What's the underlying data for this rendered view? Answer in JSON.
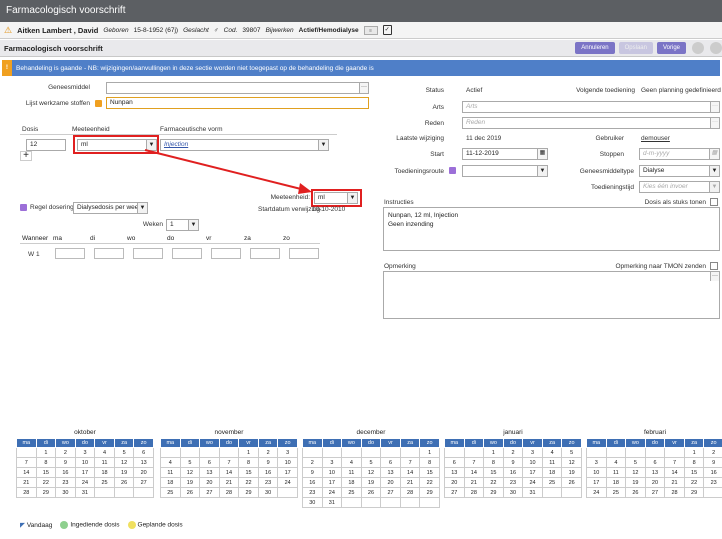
{
  "window": {
    "title": "Farmacologisch voorschrift"
  },
  "patient": {
    "name": "Aitken Lambert , David",
    "born_label": "Geboren",
    "born": "15-8-1952 (67j)",
    "sex_label": "Geslacht",
    "code_label": "Cod.",
    "code": "39807",
    "extra_label": "Bijwerken",
    "extra": "Actief/Hemodialyse"
  },
  "section": {
    "title": "Farmacologisch voorschrift",
    "buttons": {
      "cancel": "Annuleren",
      "confirm": "Opslaan",
      "prev": "Vorige"
    }
  },
  "notice": {
    "icon": "!",
    "text": "Behandeling is gaande - NB: wijzigingen/aanvullingen in deze sectie worden niet toegepast op de behandeling die gaande is"
  },
  "left": {
    "drug_label": "Geneesmiddel",
    "drug_value": "",
    "active_label": "Lijst werkzame stoffen",
    "active_value": "Nunpan",
    "dose_label": "Dosis",
    "dose_value": "12",
    "unit_label": "Meeteenheid",
    "unit_value": "ml",
    "form_label": "Farmaceutische vorm",
    "form_value": "Injection",
    "add": "+",
    "rule_label": "Regel dosering",
    "rule_value": "Dialysedosis per week",
    "unit2_label": "Meeteenheid:",
    "unit2_value": "ml",
    "start_label": "Startdatum verwijzing:",
    "start_value": "10-10-2010",
    "weeks_label": "Weken",
    "weeks_value": "1",
    "week_header": [
      "Wanneer",
      "ma",
      "di",
      "wo",
      "do",
      "vr",
      "za",
      "zo"
    ],
    "week_row": "W 1"
  },
  "right": {
    "status_label": "Status",
    "status_value": "Actief",
    "next_label": "Volgende toediening",
    "next_value": "Geen planning gedefinieerd",
    "doctor_label": "Arts",
    "doctor_ph": "Arts",
    "reason_label": "Reden",
    "reason_ph": "Reden",
    "lastmod_label": "Laatste wijziging",
    "lastmod_value": "11 dec 2019",
    "user_label": "Gebruiker",
    "user_value": "demouser",
    "start_label": "Start",
    "start_value": "11-12-2019",
    "stop_label": "Stoppen",
    "stop_ph": "d-m-yyyy",
    "route_label": "Toedieningsroute",
    "route_value": "",
    "type_label": "Geneesmiddeltype",
    "type_value": "Dialyse",
    "time_label": "Toedieningstijd",
    "time_ph": "Kies één invoer",
    "instr_label": "Instructies",
    "pieces_label": "Dosis als stuks tonen",
    "instr_line1": "Nunpan, 12 ml, Injection",
    "instr_line2": "Geen inzending",
    "remark_label": "Opmerking",
    "tmon_label": "Opmerking naar TMON zenden"
  },
  "calendar": {
    "days": [
      "ma",
      "di",
      "wo",
      "do",
      "vr",
      "za",
      "zo"
    ],
    "months": [
      {
        "name": "oktober",
        "rows": [
          [
            "",
            "1",
            "2",
            "3",
            "4",
            "5",
            "6"
          ],
          [
            "7",
            "8",
            "9",
            "10",
            "11",
            "12",
            "13"
          ],
          [
            "14",
            "15",
            "16",
            "17",
            "18",
            "19",
            "20"
          ],
          [
            "21",
            "22",
            "23",
            "24",
            "25",
            "26",
            "27"
          ],
          [
            "28",
            "29",
            "30",
            "31",
            "",
            "",
            ""
          ]
        ]
      },
      {
        "name": "november",
        "rows": [
          [
            "",
            "",
            "",
            "",
            "1",
            "2",
            "3"
          ],
          [
            "4",
            "5",
            "6",
            "7",
            "8",
            "9",
            "10"
          ],
          [
            "11",
            "12",
            "13",
            "14",
            "15",
            "16",
            "17"
          ],
          [
            "18",
            "19",
            "20",
            "21",
            "22",
            "23",
            "24"
          ],
          [
            "25",
            "26",
            "27",
            "28",
            "29",
            "30",
            ""
          ]
        ]
      },
      {
        "name": "december",
        "rows": [
          [
            "",
            "",
            "",
            "",
            "",
            "",
            "1"
          ],
          [
            "2",
            "3",
            "4",
            "5",
            "6",
            "7",
            "8"
          ],
          [
            "9",
            "10",
            "11",
            "12",
            "13",
            "14",
            "15"
          ],
          [
            "16",
            "17",
            "18",
            "19",
            "20",
            "21",
            "22"
          ],
          [
            "23",
            "24",
            "25",
            "26",
            "27",
            "28",
            "29"
          ],
          [
            "30",
            "31",
            "",
            "",
            "",
            "",
            ""
          ]
        ]
      },
      {
        "name": "januari",
        "rows": [
          [
            "",
            "",
            "1",
            "2",
            "3",
            "4",
            "5"
          ],
          [
            "6",
            "7",
            "8",
            "9",
            "10",
            "11",
            "12"
          ],
          [
            "13",
            "14",
            "15",
            "16",
            "17",
            "18",
            "19"
          ],
          [
            "20",
            "21",
            "22",
            "23",
            "24",
            "25",
            "26"
          ],
          [
            "27",
            "28",
            "29",
            "30",
            "31",
            "",
            ""
          ]
        ]
      },
      {
        "name": "februari",
        "rows": [
          [
            "",
            "",
            "",
            "",
            "",
            "1",
            "2"
          ],
          [
            "3",
            "4",
            "5",
            "6",
            "7",
            "8",
            "9"
          ],
          [
            "10",
            "11",
            "12",
            "13",
            "14",
            "15",
            "16"
          ],
          [
            "17",
            "18",
            "19",
            "20",
            "21",
            "22",
            "23"
          ],
          [
            "24",
            "25",
            "26",
            "27",
            "28",
            "29",
            ""
          ]
        ]
      }
    ]
  },
  "legend": {
    "today": "Vandaag",
    "given": "Ingediende dosis",
    "planned": "Geplande dosis"
  },
  "colors": {
    "header": "#5c5f63",
    "notice": "#4f7fc8",
    "cal_head": "#3e6fb4",
    "accent": "#7b74c6",
    "highlight": "#e02020"
  }
}
